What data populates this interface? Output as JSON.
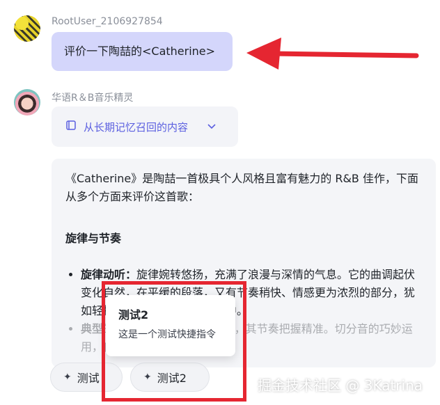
{
  "user": {
    "name": "RootUser_2106927854",
    "message": "评价一下陶喆的<Catherine>"
  },
  "bot": {
    "name": "华语R＆B音乐精灵"
  },
  "memory": {
    "label": "从长期记忆召回的内容",
    "icon": "memory-list-icon",
    "expand_icon": "chevron-down-icon"
  },
  "reply": {
    "intro": "《Catherine》是陶喆一首极具个人风格且富有魅力的 R&B 佳作，下面从多个方面来评价这首歌：",
    "section_title": "旋律与节奏",
    "bullets": [
      {
        "label": "旋律动听：",
        "text": "旋律婉转悠扬，充满了浪漫与深情的气息。它的曲调起伏变化自然，在平缓的段落，又有节奏稍快、情感更为浓烈的部分，犹如轻拂你的耳朵，让人沉浸其中。"
      },
      {
        "label": "典型",
        "text": "的 R&B 节奏与律动响应曲，其节奏把握精准。切分音的巧妙运用，使歌曲充满了律动感。"
      }
    ]
  },
  "shortcuts": [
    {
      "label": "测试",
      "icon": "sparkle-icon"
    },
    {
      "label": "测试2",
      "icon": "sparkle-icon"
    }
  ],
  "tooltip": {
    "title": "测试2",
    "description": "这是一个测试快捷指令"
  },
  "watermark": "掘金技术社区 @ 3Katrina",
  "colors": {
    "user_bubble": "#d4d6fb",
    "accent": "#5b5fe0",
    "annotation_red": "#e52631"
  }
}
